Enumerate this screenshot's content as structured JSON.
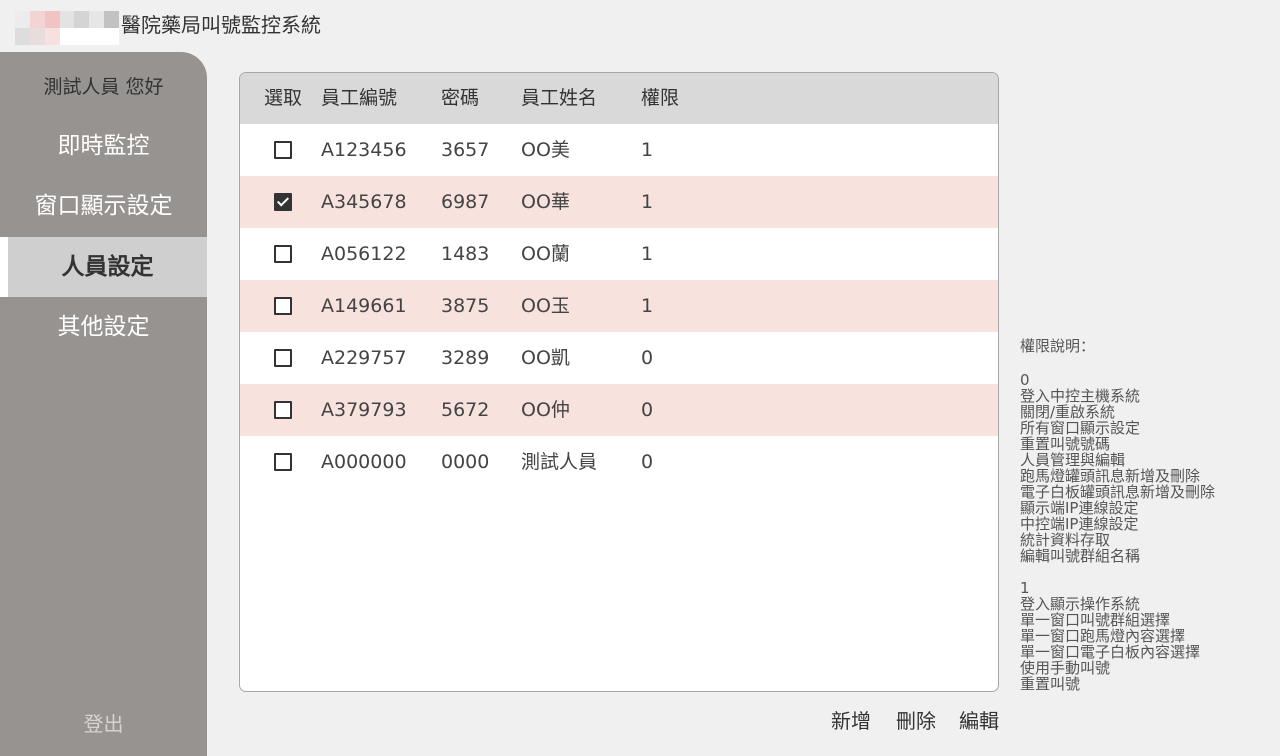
{
  "header": {
    "title": "醫院藥局叫號監控系統"
  },
  "logo": {
    "cells": [
      "#ececec",
      "#f3d3d3",
      "#f1c3c3",
      "#e3e3e3",
      "#d4d4d4",
      "#e6e6e6",
      "#c2c2c2",
      "#dddddd",
      "#e9dcdc",
      "#f6e0e0",
      "#ffffff",
      "#ffffff",
      "#ffffff",
      "#ffffff"
    ]
  },
  "sidebar": {
    "greeting": "測試人員 您好",
    "items": [
      {
        "label": "即時監控"
      },
      {
        "label": "窗口顯示設定"
      },
      {
        "label": "人員設定"
      },
      {
        "label": "其他設定"
      }
    ],
    "logout": "登出"
  },
  "table": {
    "headers": {
      "select": "選取",
      "id": "員工編號",
      "password": "密碼",
      "name": "員工姓名",
      "permission": "權限"
    },
    "rows": [
      {
        "checked": false,
        "id": "A123456",
        "password": "3657",
        "name": "OO美",
        "permission": "1"
      },
      {
        "checked": true,
        "id": "A345678",
        "password": "6987",
        "name": "OO華",
        "permission": "1"
      },
      {
        "checked": false,
        "id": "A056122",
        "password": "1483",
        "name": "OO蘭",
        "permission": "1"
      },
      {
        "checked": false,
        "id": "A149661",
        "password": "3875",
        "name": "OO玉",
        "permission": "1"
      },
      {
        "checked": false,
        "id": "A229757",
        "password": "3289",
        "name": "OO凱",
        "permission": "0"
      },
      {
        "checked": false,
        "id": "A379793",
        "password": "5672",
        "name": "OO仲",
        "permission": "0"
      },
      {
        "checked": false,
        "id": "A000000",
        "password": "0000",
        "name": "測試人員",
        "permission": "0"
      }
    ]
  },
  "notes": {
    "title": "權限說明：",
    "levels": [
      {
        "level": "0",
        "items": [
          "登入中控主機系統",
          "關閉/重啟系統",
          "所有窗口顯示設定",
          "重置叫號號碼",
          "人員管理與編輯",
          "跑馬燈罐頭訊息新增及刪除",
          "電子白板罐頭訊息新增及刪除",
          "顯示端IP連線設定",
          "中控端IP連線設定",
          "統計資料存取",
          "編輯叫號群組名稱"
        ]
      },
      {
        "level": "1",
        "items": [
          "登入顯示操作系統",
          "單一窗口叫號群組選擇",
          "單一窗口跑馬燈內容選擇",
          "單一窗口電子白板內容選擇",
          "使用手動叫號",
          "重置叫號"
        ]
      }
    ]
  },
  "actions": {
    "add": "新增",
    "delete": "刪除",
    "edit": "編輯"
  }
}
